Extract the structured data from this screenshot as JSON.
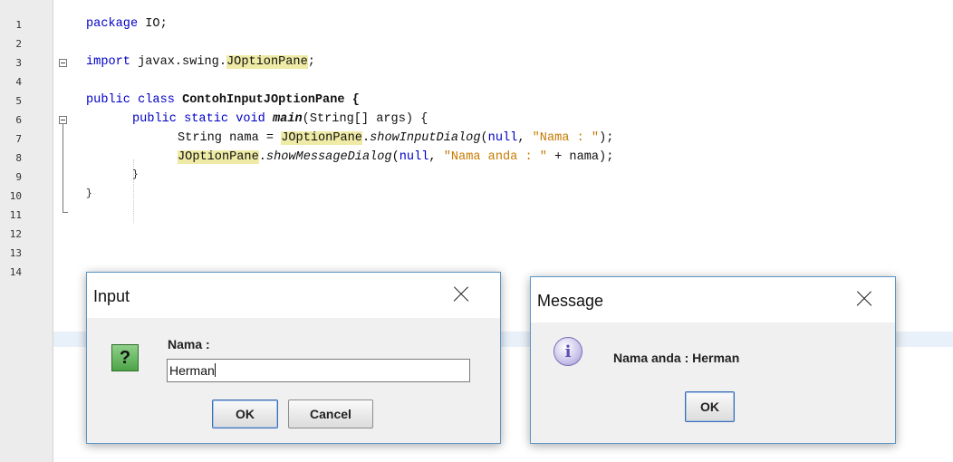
{
  "editor": {
    "line_numbers": [
      "1",
      "2",
      "3",
      "4",
      "5",
      "6",
      "7",
      "8",
      "9",
      "10",
      "11",
      "12",
      "13",
      "14"
    ],
    "lines": {
      "l1": {
        "kw": "package",
        "rest": " IO;"
      },
      "l3": {
        "kw": "import",
        "pre": " javax.swing.",
        "hl": "JOptionPane",
        "post": ";"
      },
      "l5": {
        "kw": "public class",
        "rest": " ContohInputJOptionPane {"
      },
      "l6": {
        "kw": "public static void",
        "sp": " ",
        "method": "main",
        "rest": "(String[] args) {"
      },
      "l7": {
        "pre": "String nama = ",
        "hl": "JOptionPane",
        "dot": ".",
        "method": "showInputDialog",
        "open": "(",
        "null": "null",
        "comma": ", ",
        "str": "\"Nama : \"",
        "close": ");"
      },
      "l8": {
        "hl": "JOptionPane",
        "dot": ".",
        "method": "showMessageDialog",
        "open": "(",
        "null": "null",
        "comma": ", ",
        "str": "\"Nama anda : \"",
        "close": " + nama);"
      },
      "l9": {
        "text": "}"
      },
      "l10": {
        "text": "}"
      }
    }
  },
  "input_dialog": {
    "title": "Input",
    "icon": "question-icon",
    "label": "Nama :",
    "value": "Herman",
    "ok_label": "OK",
    "cancel_label": "Cancel"
  },
  "message_dialog": {
    "title": "Message",
    "icon": "info-icon",
    "message": "Nama anda : Herman",
    "ok_label": "OK"
  },
  "colors": {
    "keyword": "#0000c8",
    "string": "#c77a00",
    "highlight": "#efeba7",
    "dialog_border": "#5a96c8"
  }
}
